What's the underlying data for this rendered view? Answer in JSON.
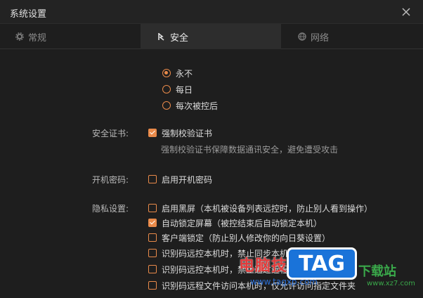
{
  "window": {
    "title": "系统设置"
  },
  "tabs": [
    {
      "label": "常规",
      "icon": "gear-icon"
    },
    {
      "label": "安全",
      "icon": "security-icon"
    },
    {
      "label": "网络",
      "icon": "globe-icon"
    }
  ],
  "access": {
    "options": [
      {
        "label": "永不",
        "selected": true
      },
      {
        "label": "每日",
        "selected": false
      },
      {
        "label": "每次被控后",
        "selected": false
      }
    ]
  },
  "certificate": {
    "label": "安全证书:",
    "option": "强制校验证书",
    "checked": true,
    "hint": "强制校验证书保障数据通讯安全，避免遭受攻击"
  },
  "boot_password": {
    "label": "开机密码:",
    "option": "启用开机密码",
    "checked": false
  },
  "privacy": {
    "label": "隐私设置:",
    "options": [
      {
        "label": "启用黑屏（本机被设备列表远控时，防止别人看到操作）",
        "checked": false
      },
      {
        "label": "自动锁定屏幕（被控结束后自动锁定本机）",
        "checked": true
      },
      {
        "label": "客户端锁定（防止别人修改你的向日葵设置）",
        "checked": false
      },
      {
        "label": "识别码远控本机时，禁止同步本机剪贴板的文字内容",
        "checked": false
      },
      {
        "label": "识别码远控本机时，禁止通过远程文件传输文件",
        "checked": false
      },
      {
        "label": "识别码远程文件访问本机时，仅允许访问指定文件夹",
        "checked": false
      }
    ]
  },
  "watermark": {
    "site": "电脑技术网",
    "url": "www.tagxp.com",
    "logo": "TAG",
    "side": "下载站",
    "side_url": "www.xz7.com"
  },
  "colors": {
    "accent": "#e98a4a",
    "background": "#1e1e1e",
    "active_tab": "#2d2d2d"
  }
}
